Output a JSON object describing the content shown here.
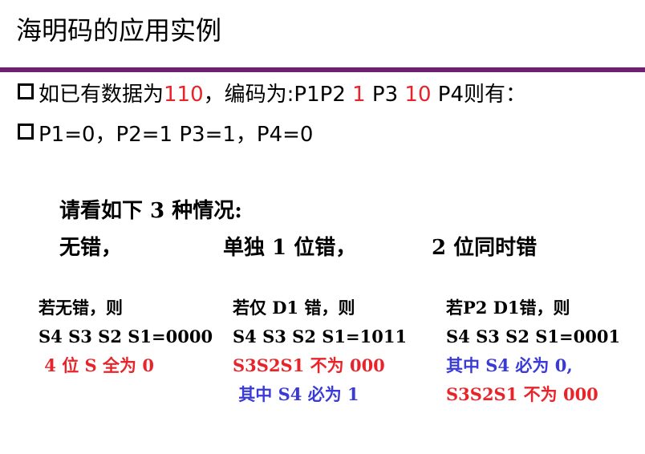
{
  "title": "海明码的应用实例",
  "bullets": {
    "line1": {
      "prefix": "如已有数据为",
      "data_bits": "110",
      "mid": "，编码为:P1P2 ",
      "bit1": "1",
      "mid2": " P3 ",
      "bit2": "10",
      "suffix": " P4则有："
    },
    "line2": "P1=0，P2=1 P3=1，P4=0"
  },
  "intro": "请看如下 3 种情况:",
  "cases": {
    "no_error": "无错，",
    "single": "单独 1 位错，",
    "double": "2 位同时错"
  },
  "columns": {
    "col1": {
      "line1": "若无错，则",
      "line2": "S4 S3 S2 S1=0000",
      "line3": " 4 位 S 全为 0"
    },
    "col2": {
      "line1": "若仅 D1 错，则",
      "line2": "S4 S3 S2 S1=1011",
      "line3": "S3S2S1 不为 000",
      "line4": " 其中 S4 必为 1"
    },
    "col3": {
      "line1": "若P2 D1错，则",
      "line2": "S4 S3 S2 S1=0001",
      "line3": "其中 S4 必为 0,",
      "line4": "S3S2S1 不为 000"
    }
  },
  "colors": {
    "accent_rule": "#6b2070",
    "highlight_red": "#e8242b",
    "highlight_blue": "#3a3ad8"
  }
}
